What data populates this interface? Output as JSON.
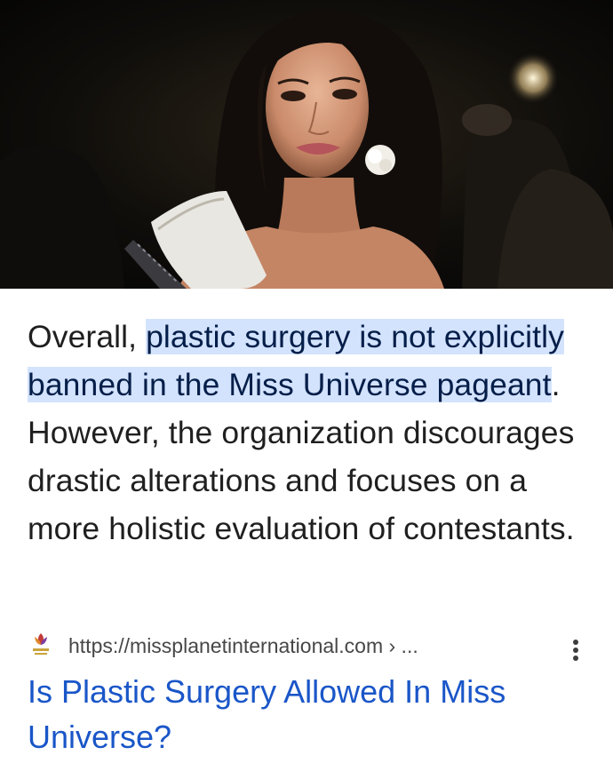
{
  "hero_image": {
    "icon": "photo-of-pageage-contestant-with-sash"
  },
  "snippet": {
    "lead": "Overall, ",
    "highlight": "plastic surgery is not explicitly banned in the Miss Universe pageant",
    "rest": ". However, the organization discourages drastic alterations and focuses on a more holistic evaluation of contestants."
  },
  "source": {
    "favicon": "missplanet-logo-icon",
    "url": "https://missplanetinternational.com › ...",
    "more_icon": "more-vert-icon"
  },
  "result": {
    "title": "Is Plastic Surgery Allowed In Miss Universe?"
  },
  "colors": {
    "highlight_bg": "#d3e3fd",
    "link": "#1a56c8",
    "text": "#1f1f1f"
  }
}
